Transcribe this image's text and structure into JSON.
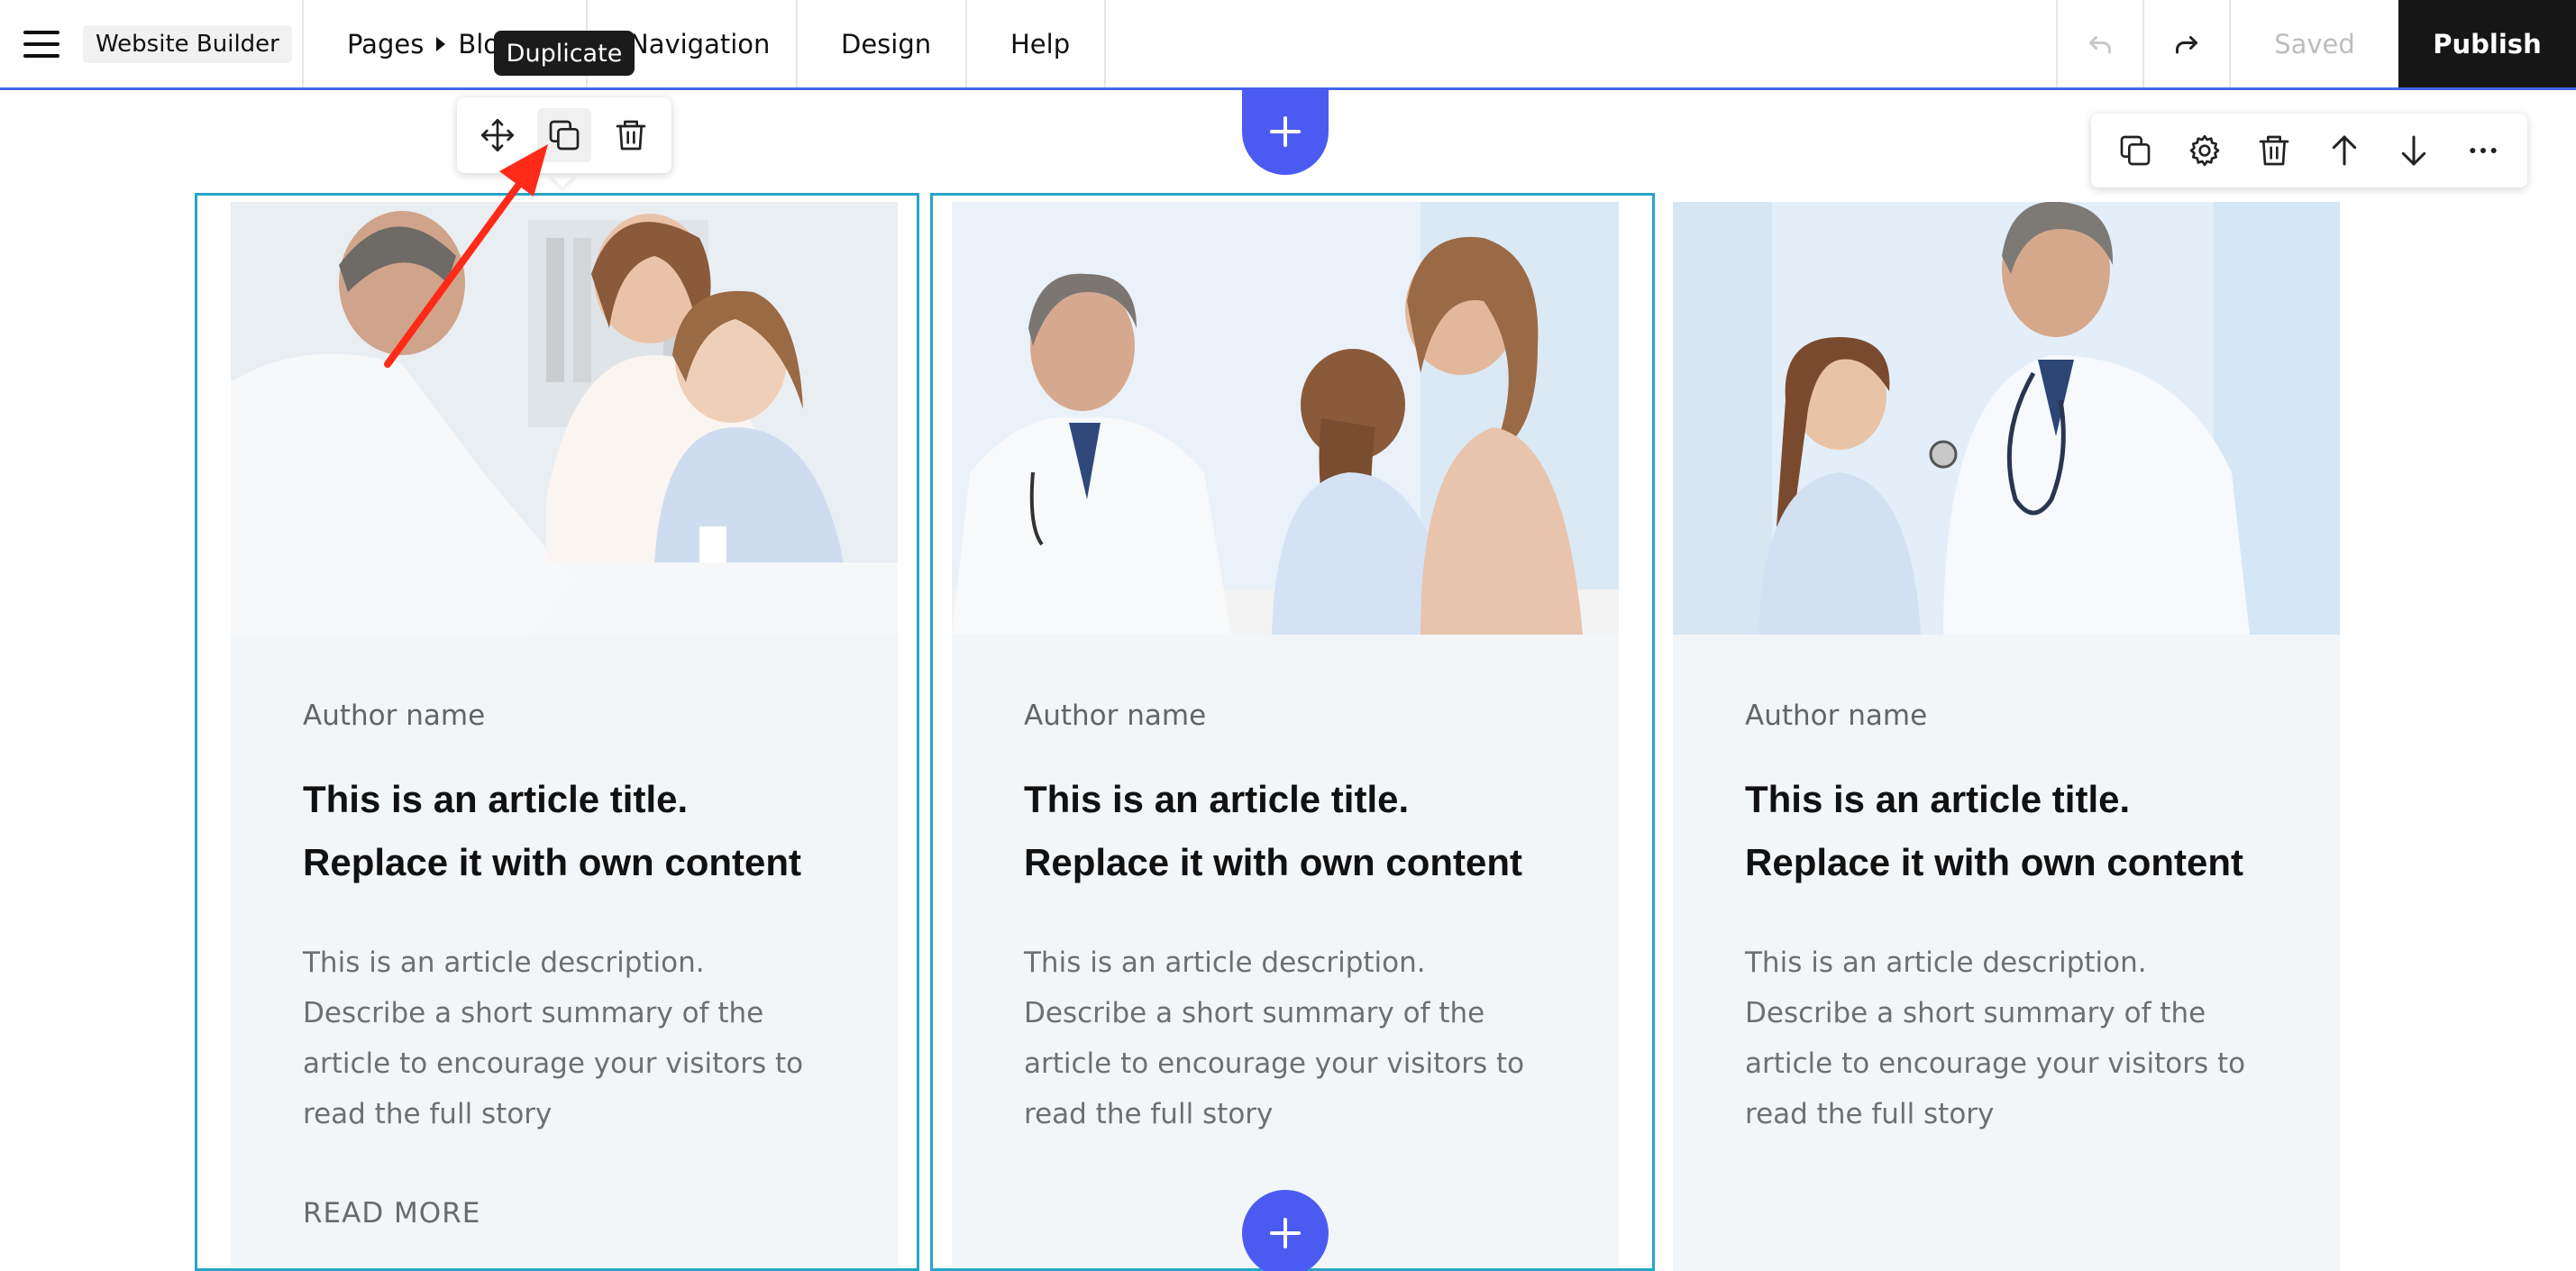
{
  "app": {
    "site_name": "Website Builder",
    "menu_icon": "hamburger-menu-icon"
  },
  "nav": {
    "pages_label": "Pages",
    "page_name": "Blog",
    "navigation_label": "Navigation",
    "design_label": "Design",
    "help_label": "Help",
    "saved_label": "Saved",
    "publish_label": "Publish"
  },
  "tooltip": {
    "text": "Duplicate"
  },
  "element_toolbar": {
    "icons": [
      "move-icon",
      "duplicate-icon",
      "delete-icon"
    ]
  },
  "section_toolbar": {
    "icons": [
      "duplicate-icon",
      "settings-icon",
      "delete-icon",
      "move-up-icon",
      "move-down-icon",
      "more-icon"
    ]
  },
  "cards": [
    {
      "photo": "doctor-with-mother-and-daughter-photo",
      "author": "Author name",
      "title": "This is an article title. Replace it with own content",
      "description": "This is an article description. Describe a short summary of the article to encourage your visitors to read the full story",
      "read_more": "READ MORE"
    },
    {
      "photo": "smiling-doctor-with-family-photo",
      "author": "Author name",
      "title": "This is an article title. Replace it with own content",
      "description": "This is an article description. Describe a short summary of the article to encourage your visitors to read the full story"
    },
    {
      "photo": "doctor-with-stethoscope-and-girl-photo",
      "author": "Author name",
      "title": "This is an article title. Replace it with own content",
      "description": "This is an article description. Describe a short summary of the article to encourage your visitors to read the full story"
    }
  ],
  "colors": {
    "accent_blue": "#4b5bf2",
    "selection_cyan": "#25a6c6",
    "publish_bg": "#161616",
    "card_bg": "#f3f6f9",
    "annotation_red": "#ff2a17"
  }
}
